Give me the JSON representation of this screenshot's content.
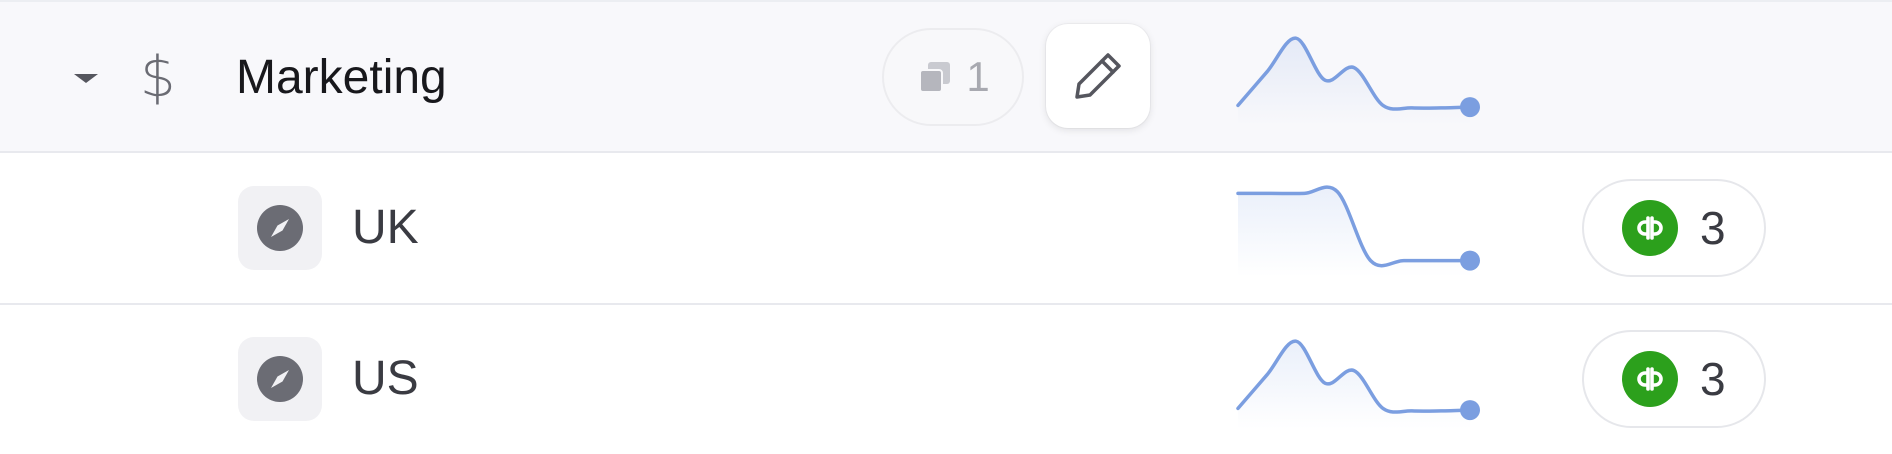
{
  "group": {
    "title": "Marketing",
    "linked_count": "1",
    "icon": "dollar-sign-icon",
    "expanded": true,
    "sparkline": [
      0.15,
      0.55,
      0.95,
      0.45,
      0.6,
      0.15,
      0.12,
      0.12,
      0.13
    ]
  },
  "rows": [
    {
      "label": "UK",
      "icon": "compass-icon",
      "source": {
        "name": "QuickBooks",
        "icon": "quickbooks-icon",
        "count": "3"
      },
      "sparkline": [
        0.9,
        0.9,
        0.9,
        0.92,
        0.1,
        0.1,
        0.1,
        0.1
      ]
    },
    {
      "label": "US",
      "icon": "compass-icon",
      "source": {
        "name": "QuickBooks",
        "icon": "quickbooks-icon",
        "count": "3"
      },
      "sparkline": [
        0.15,
        0.55,
        0.95,
        0.45,
        0.6,
        0.15,
        0.12,
        0.12,
        0.13
      ]
    }
  ],
  "colors": {
    "sparkline": "#7b9ee0",
    "quickbooks": "#2ca01c",
    "group_bg": "#f8f8fb"
  }
}
